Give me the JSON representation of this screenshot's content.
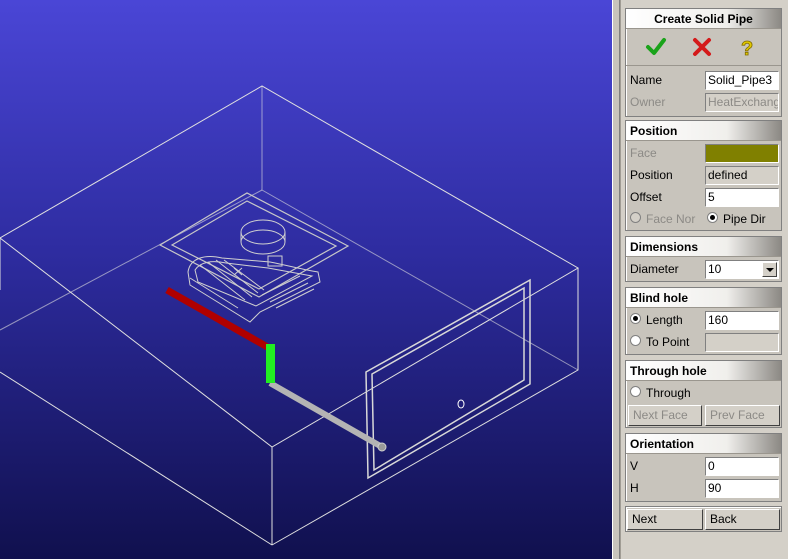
{
  "dialog": {
    "title": "Create Solid Pipe",
    "toolbar": {
      "ok_icon": "check-icon",
      "cancel_icon": "cross-icon",
      "help_icon": "question-icon",
      "ok_color": "#1aa31a",
      "cancel_color": "#d41a1a",
      "help_color": "#e0c800"
    },
    "name_label": "Name",
    "name_value": "Solid_Pipe3",
    "owner_label": "Owner",
    "owner_value": "HeatExchange"
  },
  "position": {
    "title": "Position",
    "face_label": "Face",
    "face_color": "#808000",
    "position_label": "Position",
    "position_value": "defined",
    "offset_label": "Offset",
    "offset_value": "5",
    "face_nor_label": "Face Nor",
    "pipe_dir_label": "Pipe Dir",
    "selected": "Pipe Dir"
  },
  "dimensions": {
    "title": "Dimensions",
    "diameter_label": "Diameter",
    "diameter_value": "10"
  },
  "blind_hole": {
    "title": "Blind hole",
    "length_label": "Length",
    "length_value": "160",
    "to_point_label": "To Point",
    "to_point_value": "",
    "selected": "Length"
  },
  "through_hole": {
    "title": "Through hole",
    "through_label": "Through",
    "next_face_label": "Next Face",
    "prev_face_label": "Prev Face"
  },
  "orientation": {
    "title": "Orientation",
    "v_label": "V",
    "v_value": "0",
    "h_label": "H",
    "h_value": "90"
  },
  "footer": {
    "next_label": "Next",
    "back_label": "Back"
  },
  "viewport": {
    "background_top": "#4a46d6",
    "background_bottom": "#10104e",
    "wire_color": "#e0e0e0",
    "axis_red": "#b00000",
    "axis_green": "#22ee22",
    "pipe_color": "#b4b4b4"
  }
}
